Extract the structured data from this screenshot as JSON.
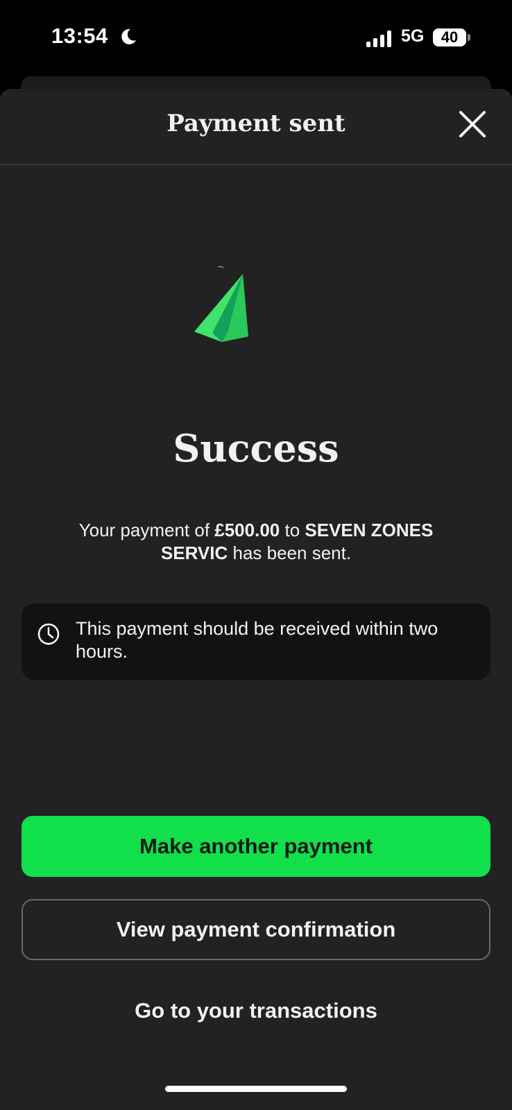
{
  "status_bar": {
    "time": "13:54",
    "network": "5G",
    "battery": "40"
  },
  "header": {
    "title": "Payment sent"
  },
  "main": {
    "heading": "Success",
    "message_prefix": "Your payment of ",
    "amount": "£500.00",
    "message_mid": " to ",
    "payee": "SEVEN ZONES SERVIC",
    "message_suffix": " has been sent.",
    "info_text": "This payment should be received within two hours."
  },
  "actions": {
    "primary_label": "Make another payment",
    "secondary_label": "View payment confirmation",
    "link_label": "Go to your transactions"
  },
  "colors": {
    "accent_green": "#12e04b",
    "sheet_bg": "#222222",
    "card_bg": "#121212"
  },
  "icons": [
    "moon-icon",
    "signal-icon",
    "battery-icon",
    "close-icon",
    "paper-plane-icon",
    "clock-icon"
  ]
}
